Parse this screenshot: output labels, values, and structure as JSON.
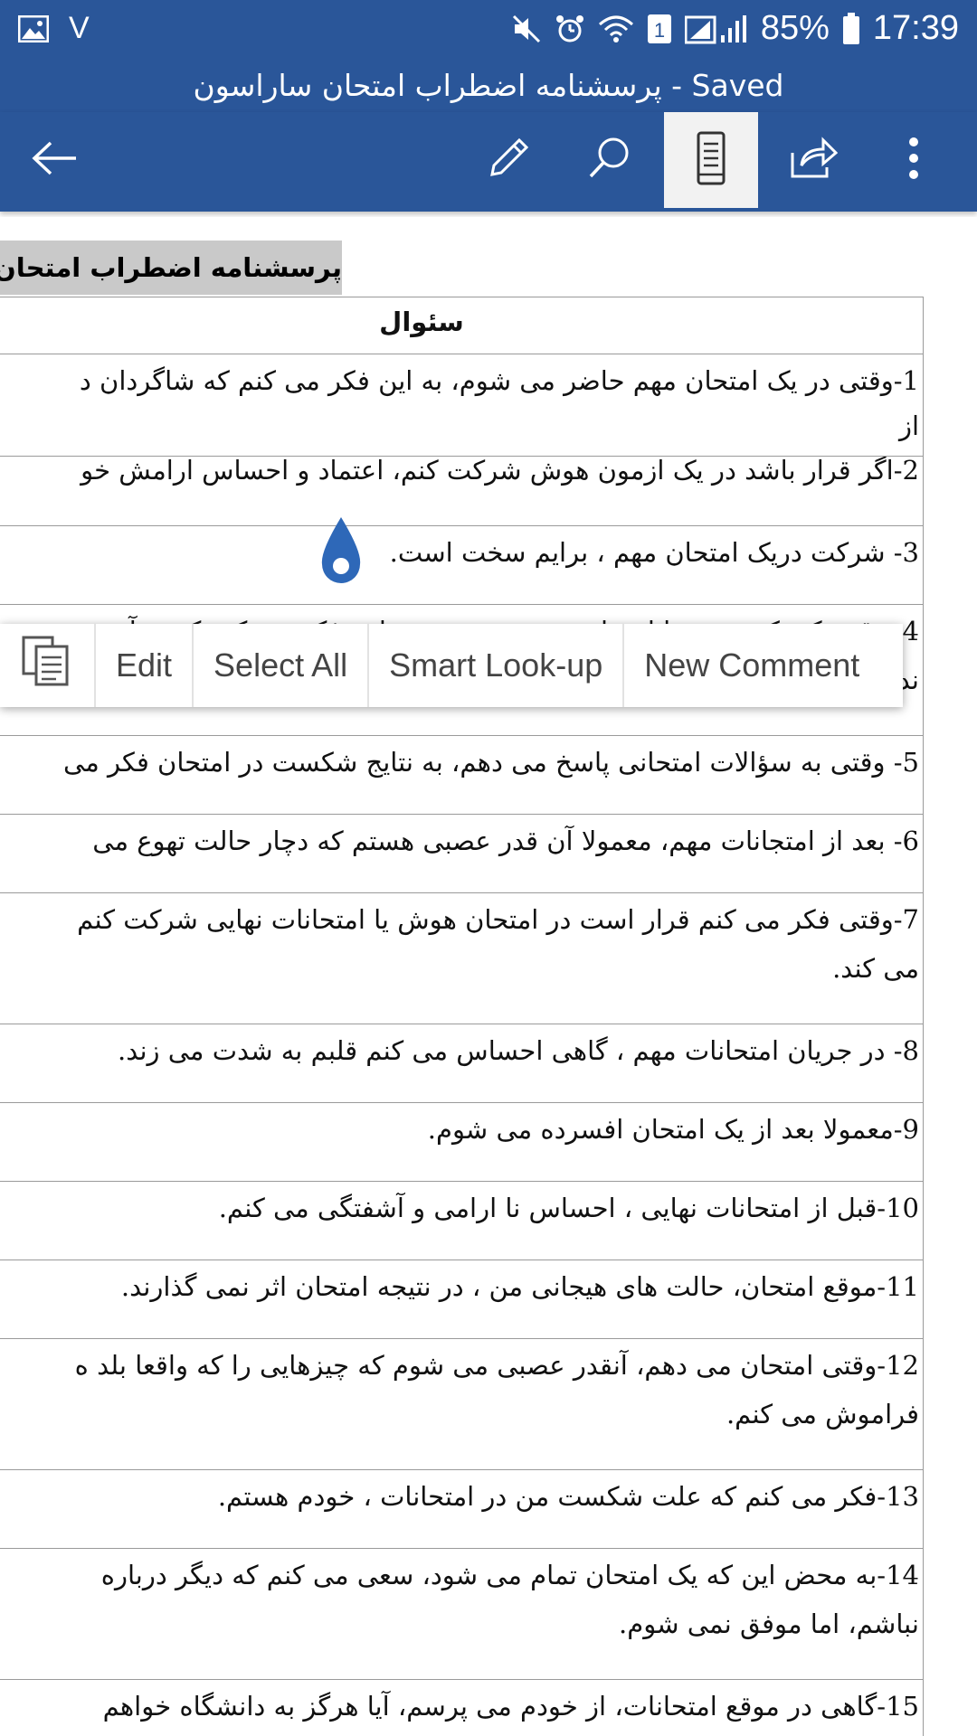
{
  "status_bar": {
    "left_indicator": "V",
    "battery": "85%",
    "time": "17:39",
    "icons": [
      "gallery-icon",
      "mute-icon",
      "alarm-icon",
      "wifi-icon",
      "sim-icon",
      "signal-icon",
      "battery-icon"
    ]
  },
  "title_bar": {
    "title": "پرسشنامه اضطراب امتحان ساراسون - Saved"
  },
  "toolbar": {
    "icons": [
      "back-arrow-icon",
      "edit-pencil-icon",
      "search-icon",
      "mobile-view-icon",
      "share-icon",
      "more-icon"
    ]
  },
  "colors": {
    "header_blue": "#2a5699",
    "active_tab": "#f2f2f2",
    "selection_highlight": "#c9c9c9",
    "cursor_handle": "#2e68b8"
  },
  "document": {
    "title": "پرسشنامه اضطراب امتحان س",
    "table_header": "سئوال",
    "rows": [
      [
        "1-وقتی در یک امتحان مهم حاضر می شوم، به این فکر می کنم که شاگردان د",
        "از"
      ],
      [
        "2-اگر قرار باشد در یک ازمون هوش شرکت کنم، اعتماد و احساس ارامش خو"
      ],
      [
        "3- شرکت دریک امتحان مهم ، برایم سخت است."
      ],
      [
        "4- وقتی که یک درس را امتحان می دهم، به چیزهایی فکر می کنم که به آن د",
        "ندارند."
      ],
      [
        "5- وقتی به سؤالات امتحانی پاسخ می دهم، به نتایج شکست در امتحان فکر می"
      ],
      [
        "6- بعد از امتجانات مهم، معمولا آن قدر عصبی هستم که دچار حالت تهوع می"
      ],
      [
        "7-وقتی فکر می کنم قرار است در امتحان هوش یا امتحانات نهایی شرکت کنم",
        "می کند."
      ],
      [
        "8- در جریان امتحانات مهم ، گاهی احساس می کنم قلبم به شدت می زند."
      ],
      [
        "9-معمولا بعد از یک امتحان افسرده می شوم."
      ],
      [
        "10-قبل از امتحانات نهایی ، احساس نا ارامی و آشفتگی می کنم."
      ],
      [
        "11-موقع امتحان، حالت های هیجانی من ، در نتیجه امتحان اثر نمی گذارند."
      ],
      [
        "12-وقتی امتحان می دهم، آنقدر عصبی می شوم که چیزهایی را که واقعا بلد ه",
        "فراموش می کنم."
      ],
      [
        "13-فکر می کنم که علت شکست من در امتحانات ، خودم هستم."
      ],
      [
        "14-به محض این که یک امتحان تمام می شود، سعی می کنم که دیگر درباره",
        "نباشم، اما موفق نمی شوم."
      ],
      [
        "15-گاهی در موقع امتحانات، از خودم می پرسم، آیا هرگز به دانشگاه خواهم"
      ]
    ]
  },
  "context_menu": {
    "items": [
      "Edit",
      "Select All",
      "Smart Look-up",
      "New Comment"
    ],
    "icons": [
      "copy-icon"
    ]
  }
}
